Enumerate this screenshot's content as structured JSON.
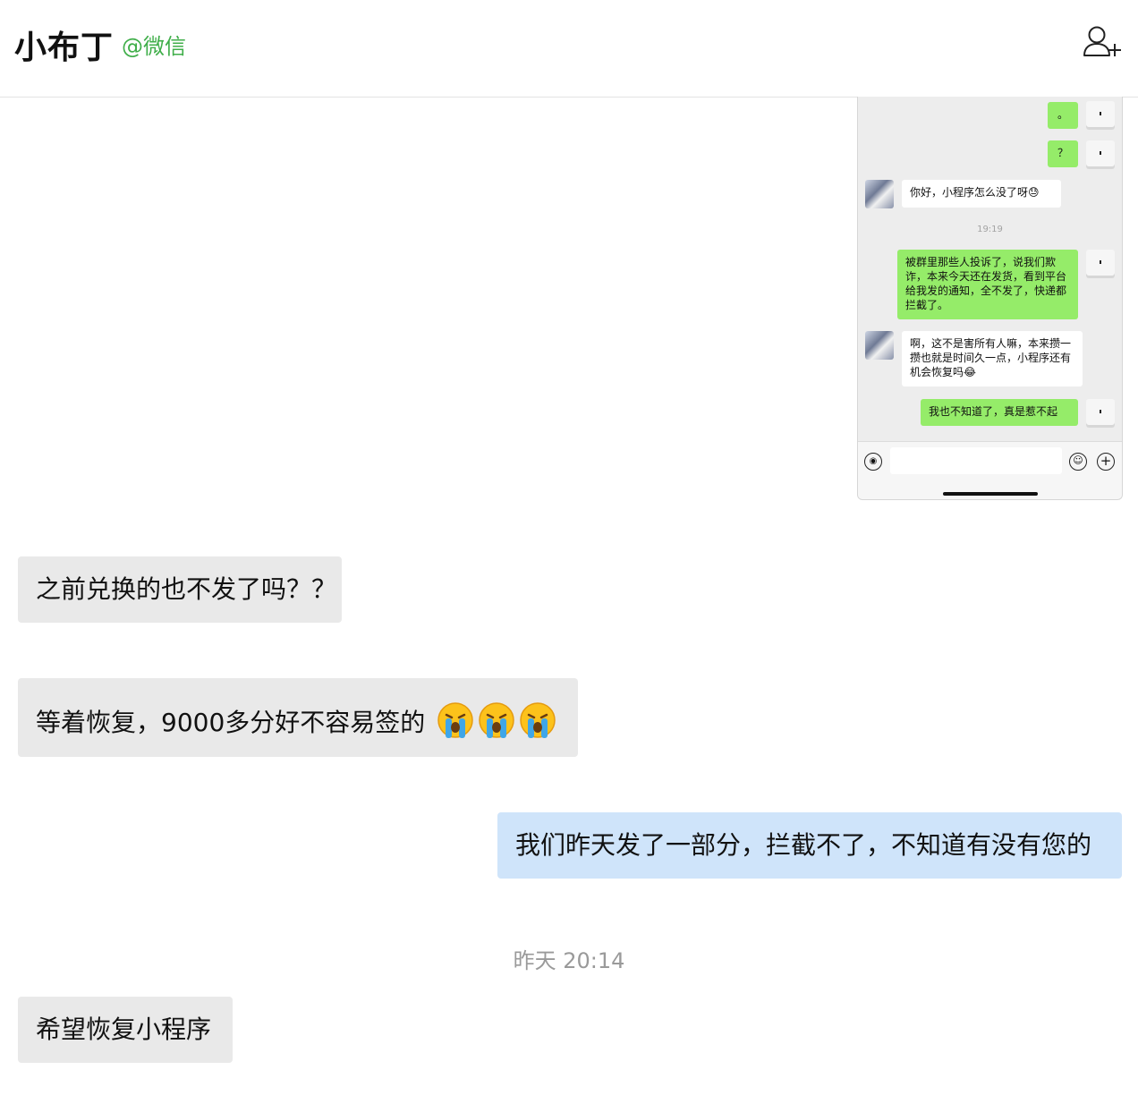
{
  "header": {
    "contact_name": "小布丁",
    "source": "@微信",
    "add_friend_icon": "add-user-icon"
  },
  "screenshot": {
    "bubbles": {
      "b1": "。",
      "b2": "？",
      "b3": "你好，小程序怎么没了呀😓",
      "b4": "被群里那些人投诉了，说我们欺诈，本来今天还在发货，看到平台给我发的通知，全不发了，快递都拦截了。",
      "b5": "啊，这不是害所有人嘛，本来攒一攒也就是时间久一点，小程序还有机会恢复吗😂",
      "b6": "我也不知道了，真是惹不起"
    },
    "time": "19:19"
  },
  "messages": {
    "m1": "之前兑换的也不发了吗？？",
    "m2": "等着恢复，9000多分好不容易签的",
    "m2_emoji": "crying-face-emoji",
    "m3": "我们昨天发了一部分，拦截不了，不知道有没有您的",
    "m4": "希望恢复小程序"
  },
  "time_separator": "昨天 20:14",
  "colors": {
    "source_green": "#3fae49",
    "wechat_green": "#95ec69",
    "received_bubble": "#e9e9e9",
    "sent_bubble": "#cfe4fa"
  }
}
